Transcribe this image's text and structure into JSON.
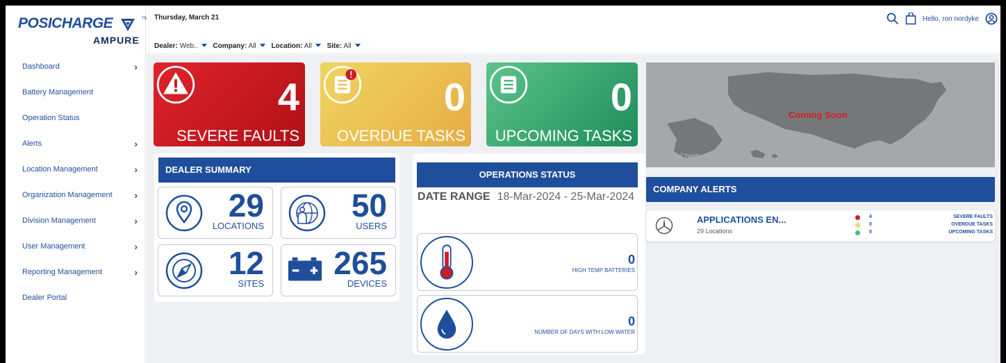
{
  "brand": {
    "name": "POSICHARGE",
    "tm": "TM",
    "sub": "AMPURE"
  },
  "colors": {
    "primary": "#1e4e9c",
    "severe": "#d01c23",
    "overdue": "#e9c052",
    "upcoming": "#2fa56b",
    "coming_soon": "#d41f1f"
  },
  "sidebar": {
    "items": [
      {
        "label": "Dashboard",
        "arrow": true
      },
      {
        "label": "Battery Management",
        "arrow": false
      },
      {
        "label": "Operation Status",
        "arrow": false
      },
      {
        "label": "Alerts",
        "arrow": true
      },
      {
        "label": "Location Management",
        "arrow": true
      },
      {
        "label": "Organization Management",
        "arrow": true
      },
      {
        "label": "Division Management",
        "arrow": true
      },
      {
        "label": "User Management",
        "arrow": true
      },
      {
        "label": "Reporting Management",
        "arrow": true
      },
      {
        "label": "Dealer Portal",
        "arrow": false
      }
    ]
  },
  "header": {
    "date": "Thursday, March 21",
    "greeting": "Hello, ron nordyke",
    "filters": [
      {
        "label": "Dealer:",
        "value": "Web.."
      },
      {
        "label": "Company:",
        "value": "All"
      },
      {
        "label": "Location:",
        "value": "All"
      },
      {
        "label": "Site:",
        "value": "All"
      }
    ]
  },
  "cards": {
    "severe": {
      "value": "4",
      "label": "SEVERE FAULTS"
    },
    "overdue": {
      "value": "0",
      "label": "OVERDUE TASKS"
    },
    "upcoming": {
      "value": "0",
      "label": "UPCOMING TASKS"
    }
  },
  "map": {
    "coming_soon": "Coming Soon",
    "watermark": "FusionCharts Trial"
  },
  "dealer_summary": {
    "title": "DEALER SUMMARY",
    "locations": {
      "value": "29",
      "label": "LOCATIONS"
    },
    "users": {
      "value": "50",
      "label": "USERS"
    },
    "sites": {
      "value": "12",
      "label": "SITES"
    },
    "devices": {
      "value": "265",
      "label": "DEVICES"
    }
  },
  "operations_status": {
    "title": "OPERATIONS STATUS",
    "range_label": "DATE RANGE",
    "range_value": "18-Mar-2024 - 25-Mar-2024",
    "high_temp": {
      "value": "0",
      "label": "HIGH TEMP BATTERIES"
    },
    "low_water": {
      "value": "0",
      "label": "NUMBER OF DAYS WITH LOW WATER"
    }
  },
  "company_alerts": {
    "title": "COMPANY ALERTS",
    "row": {
      "name": "APPLICATIONS EN...",
      "locations": "29 Locations",
      "severe": {
        "value": "4",
        "label": "SEVERE FAULTS"
      },
      "overdue": {
        "value": "0",
        "label": "OVERDUE TASKS"
      },
      "upcoming": {
        "value": "0",
        "label": "UPCOMING TASKS"
      }
    }
  }
}
